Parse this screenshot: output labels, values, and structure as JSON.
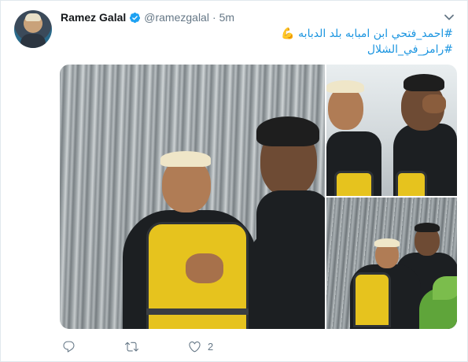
{
  "tweet": {
    "author_name": "Ramez Galal",
    "handle": "@ramezgalal",
    "separator": "·",
    "timestamp": "5m",
    "lines": [
      {
        "text": "#احمد_فتحي ابن امبابه بلد الدبابه",
        "emoji": "💪"
      },
      {
        "text": "#رامز_في_الشلال"
      }
    ],
    "like_count": "2",
    "reply_count": "",
    "retweet_count": ""
  },
  "colors": {
    "link": "#1b95e0",
    "muted": "#657786",
    "verified": "#1da1f2",
    "border": "#e1e8ed"
  },
  "icons": {
    "verified": "verified-badge-icon",
    "caret": "chevron-down-icon",
    "reply": "reply-icon",
    "retweet": "retweet-icon",
    "like": "heart-icon"
  }
}
